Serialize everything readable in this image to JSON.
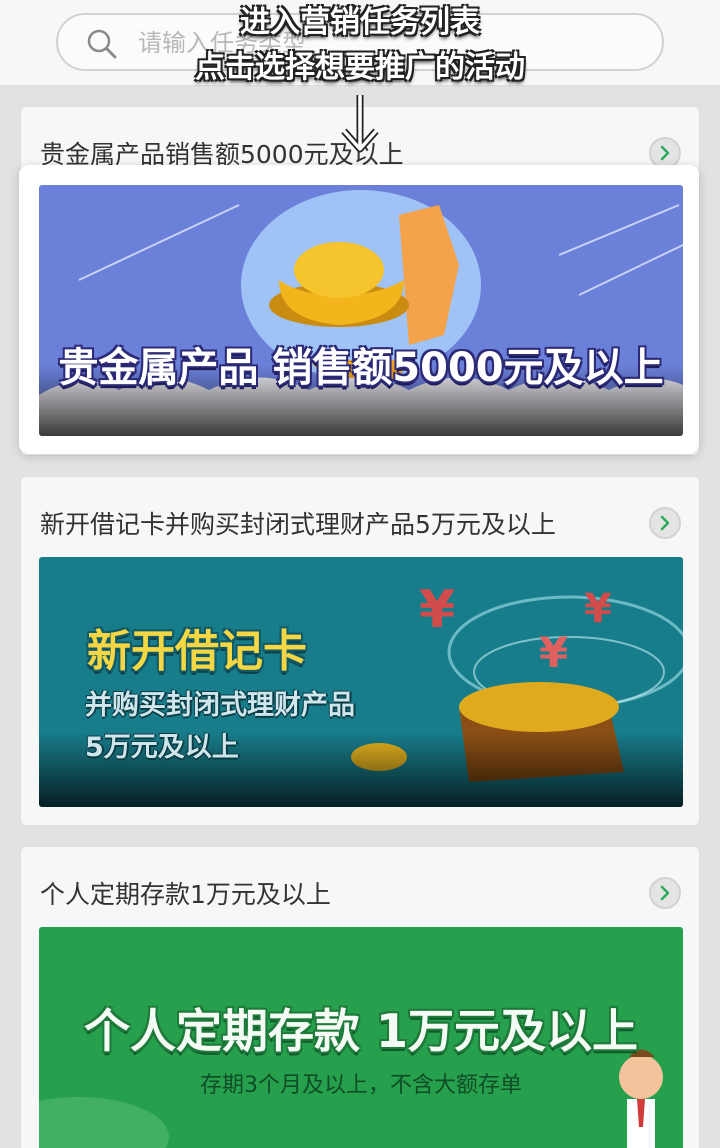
{
  "search": {
    "placeholder": "请输入任务类型"
  },
  "annotation": {
    "line1": "进入营销任务列表",
    "line2": "点击选择想要推广的活动"
  },
  "tasks": [
    {
      "title": "贵金属产品销售额5000元及以上",
      "banner_lines": [
        "贵金属产品 销售额5000元及以上"
      ],
      "banner_color": "#6a7fd8"
    },
    {
      "title": "新开借记卡并购买封闭式理财产品5万元及以上",
      "banner_lines": [
        "新开借记卡",
        "并购买封闭式理财产品",
        "5万元及以上"
      ],
      "banner_color": "#177e8c"
    },
    {
      "title": "个人定期存款1万元及以上",
      "banner_lines": [
        "个人定期存款 1万元及以上",
        "存期3个月及以上，不含大额存单"
      ],
      "banner_color": "#239a4a"
    }
  ],
  "icons": {
    "search": "search-icon",
    "chevron": "chevron-right-icon",
    "arrow": "arrow-down-icon"
  }
}
